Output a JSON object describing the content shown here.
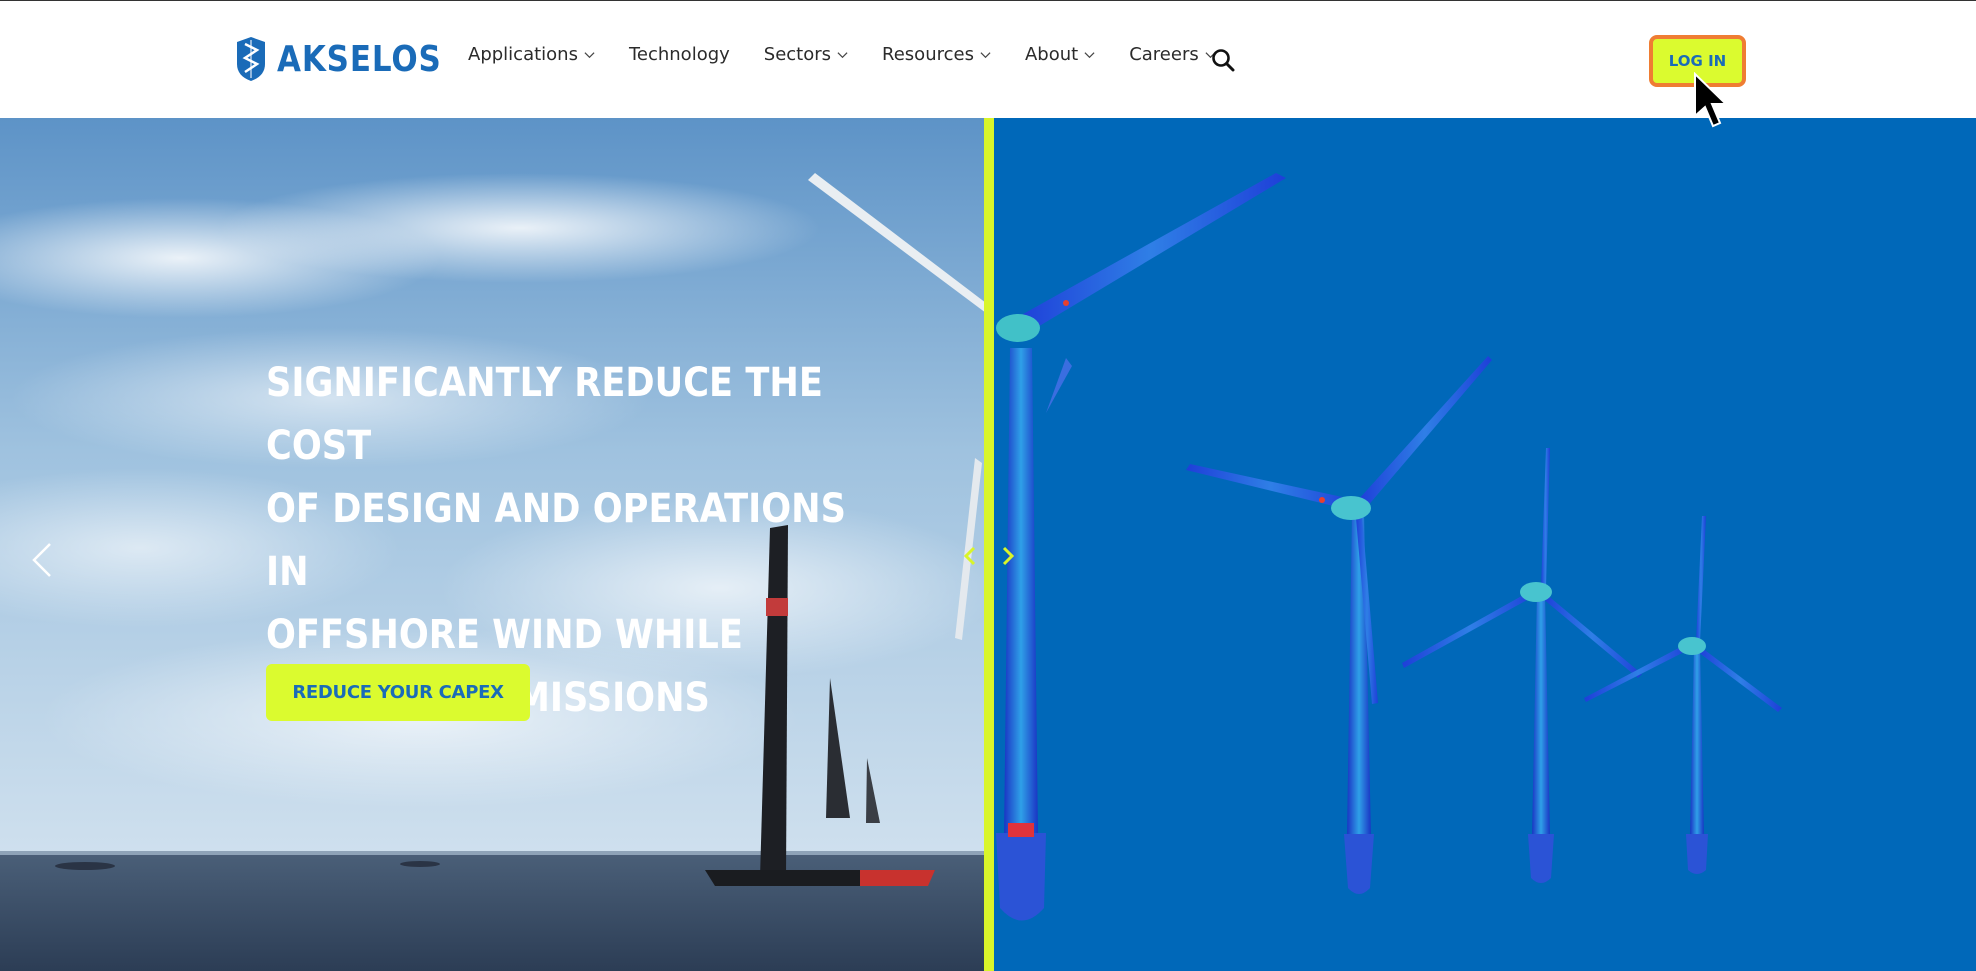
{
  "header": {
    "logo_text": "AKSELOS",
    "nav": [
      {
        "label": "Applications",
        "has_dropdown": true
      },
      {
        "label": "Technology",
        "has_dropdown": false
      },
      {
        "label": "Sectors",
        "has_dropdown": true
      },
      {
        "label": "Resources",
        "has_dropdown": true
      },
      {
        "label": "About",
        "has_dropdown": true
      },
      {
        "label": "Careers",
        "has_dropdown": true
      }
    ],
    "search_icon": "search-icon",
    "login_label": "LOG IN"
  },
  "hero": {
    "headline_lines": [
      "SIGNIFICANTLY REDUCE THE COST",
      "OF DESIGN AND OPERATIONS IN",
      "OFFSHORE WIND WHILE",
      "LOWERING EMISSIONS"
    ],
    "cta_label": "REDUCE YOUR CAPEX",
    "prev_icon": "chevron-left-icon",
    "next_icon": "chevron-right-icon"
  },
  "colors": {
    "brand_blue": "#1a6bb8",
    "accent_lime": "#dbfb2f",
    "highlight_orange": "#ef7d33",
    "simulation_bg": "#0068b9"
  }
}
